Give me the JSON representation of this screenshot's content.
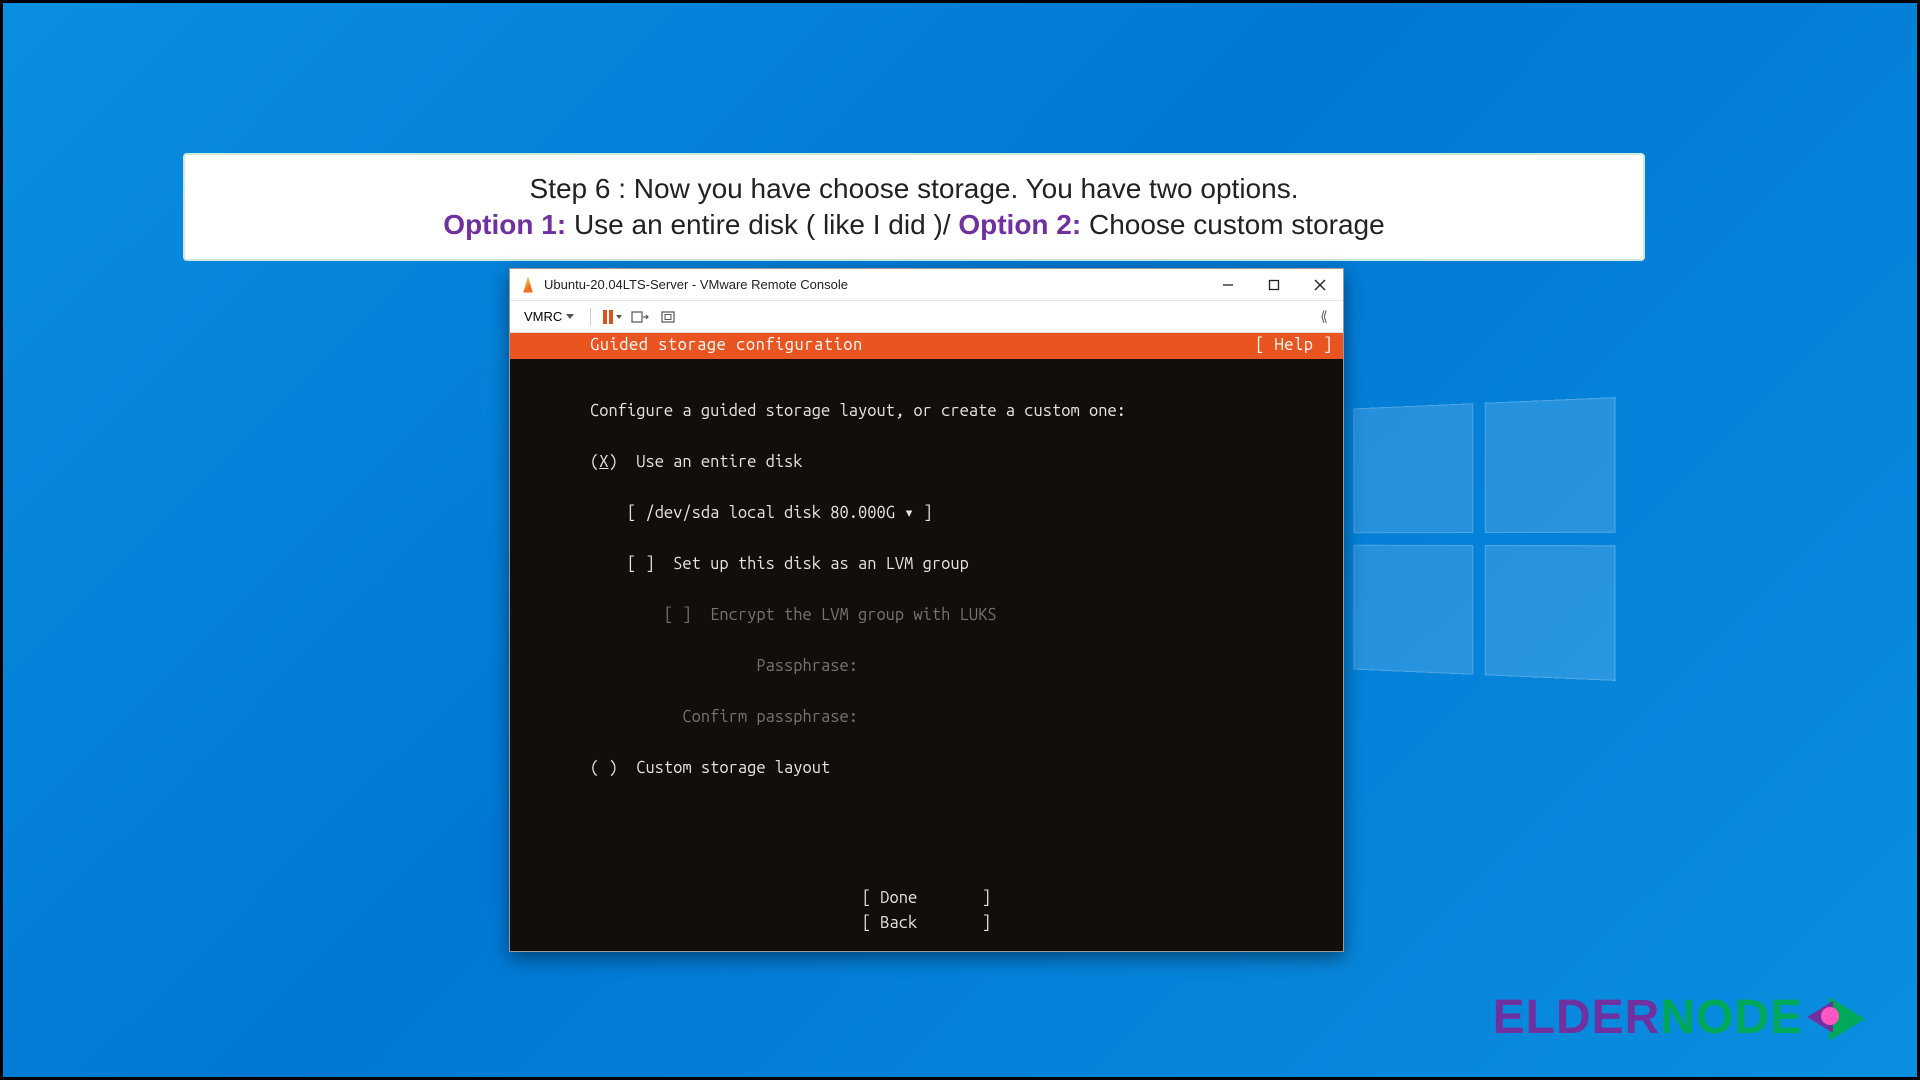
{
  "banner": {
    "line1": "Step 6 : Now you have choose storage. You have two options.",
    "opt1_label": "Option 1:",
    "opt1_text": " Use an entire disk ( like I did )/ ",
    "opt2_label": "Option 2:",
    "opt2_text": " Choose custom storage"
  },
  "window": {
    "title": "Ubuntu-20.04LTS-Server - VMware Remote Console",
    "menu_label": "VMRC"
  },
  "installer": {
    "header_title": "Guided storage configuration",
    "header_help": "[ Help ]",
    "intro": "Configure a guided storage layout, or create a custom one:",
    "radio_entire_prefix": "(",
    "radio_entire_mark": "X",
    "radio_entire_suffix": ")  Use an entire disk",
    "disk_select": "[ /dev/sda local disk 80.000G ▾ ]",
    "lvm_checkbox": "[ ]  Set up this disk as an LVM group",
    "luks_checkbox": "[ ]  Encrypt the LVM group with LUKS",
    "pass_label": "Passphrase:",
    "confirm_label": "Confirm passphrase:",
    "radio_custom": "( )  Custom storage layout",
    "done": "[ Done       ]",
    "back": "[ Back       ]"
  },
  "brand": {
    "part1": "ELDER",
    "part2": "NODE"
  }
}
